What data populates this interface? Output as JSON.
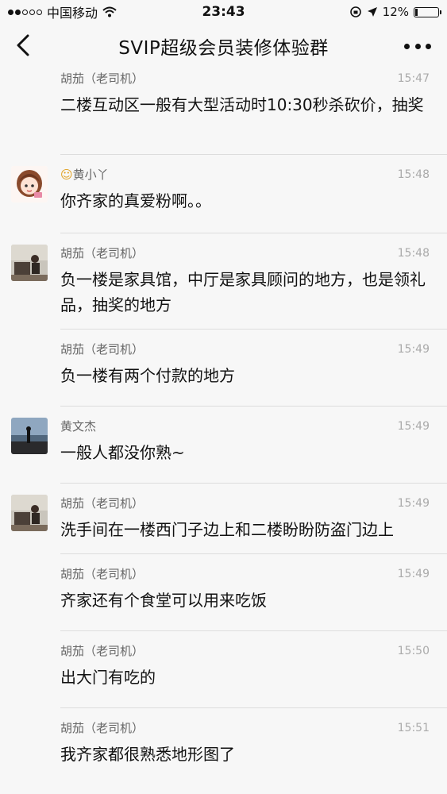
{
  "status_bar": {
    "carrier": "中国移动",
    "time": "23:43",
    "battery": "12%",
    "battery_fraction": 0.12
  },
  "nav": {
    "title": "SVIP超级会员装修体验群"
  },
  "messages": [
    {
      "name": "胡茄（老司机）",
      "time": "15:47",
      "text": "二楼互动区一般有大型活动时10:30秒杀砍价，抽奖"
    },
    {
      "name": "黄小丫",
      "time": "15:48",
      "text": "你齐家的真爱粉啊。。"
    },
    {
      "name": "胡茄（老司机）",
      "time": "15:48",
      "text": "负一楼是家具馆，中厅是家具顾问的地方，也是领礼品，抽奖的地方"
    },
    {
      "name": "胡茄（老司机）",
      "time": "15:49",
      "text": "负一楼有两个付款的地方"
    },
    {
      "name": "黄文杰",
      "time": "15:49",
      "text": "一般人都没你熟~"
    },
    {
      "name": "胡茄（老司机）",
      "time": "15:49",
      "text": "洗手间在一楼西门子边上和二楼盼盼防盗门边上"
    },
    {
      "name": "胡茄（老司机）",
      "time": "15:49",
      "text": "齐家还有个食堂可以用来吃饭"
    },
    {
      "name": "胡茄（老司机）",
      "time": "15:50",
      "text": "出大门有吃的"
    },
    {
      "name": "胡茄（老司机）",
      "time": "15:51",
      "text": "我齐家都很熟悉地形图了"
    }
  ]
}
